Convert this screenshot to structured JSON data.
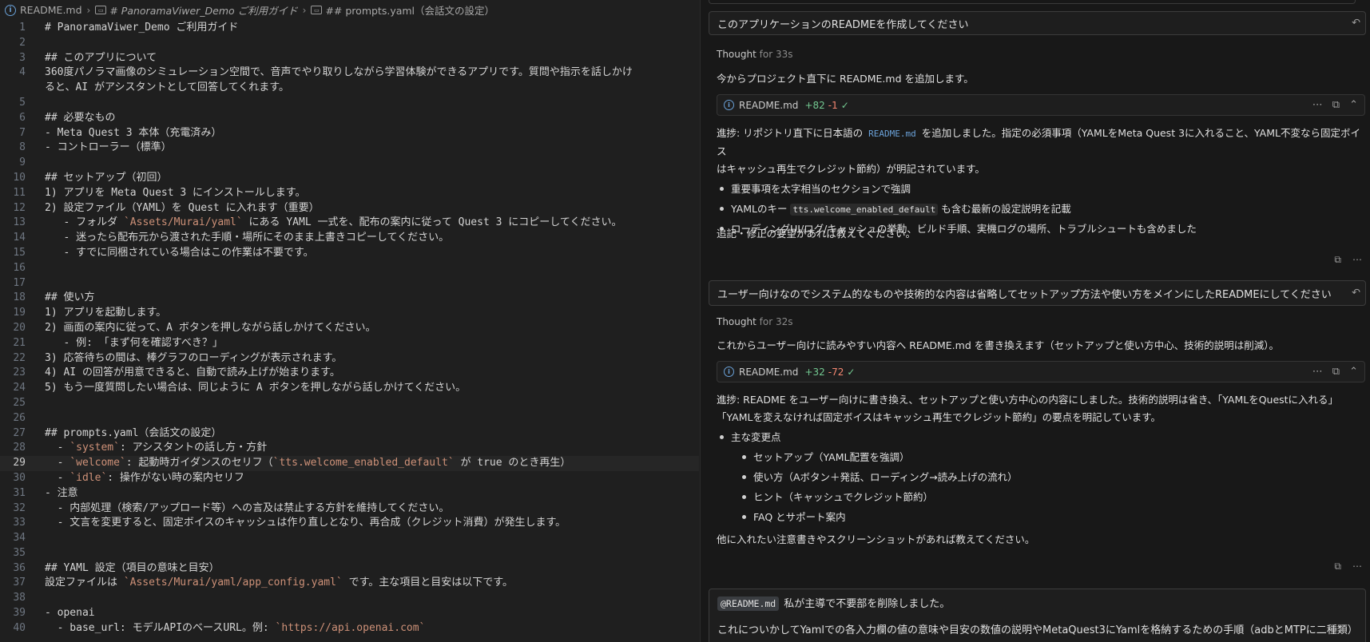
{
  "breadcrumb": {
    "file": "README.md",
    "section1": "# PanoramaViwer_Demo ご利用ガイド",
    "section2": "## prompts.yaml（会話文の設定）"
  },
  "editor": {
    "current_line": 29,
    "lines": [
      {
        "n": "1",
        "t": "# PanoramaViwer_Demo ご利用ガイド"
      },
      {
        "n": "2",
        "t": ""
      },
      {
        "n": "3",
        "t": "## このアプリについて"
      },
      {
        "n": "4",
        "t": "360度パノラマ画像のシミュレーション空間で、音声でやり取りしながら学習体験ができるアプリです。質問や指示を話しかけ"
      },
      {
        "n": "",
        "t": "ると、AI がアシスタントとして回答してくれます。"
      },
      {
        "n": "5",
        "t": ""
      },
      {
        "n": "6",
        "t": "## 必要なもの"
      },
      {
        "n": "7",
        "t": "- Meta Quest 3 本体（充電済み）"
      },
      {
        "n": "8",
        "t": "- コントローラー（標準）"
      },
      {
        "n": "9",
        "t": ""
      },
      {
        "n": "10",
        "t": "## セットアップ（初回）"
      },
      {
        "n": "11",
        "t": "1) アプリを Meta Quest 3 にインストールします。"
      },
      {
        "n": "12",
        "t": "2) 設定ファイル（YAML）を Quest に入れます（重要）"
      },
      {
        "n": "13",
        "t": "   - フォルダ `Assets/Murai/yaml` にある YAML 一式を、配布の案内に従って Quest 3 にコピーしてください。"
      },
      {
        "n": "14",
        "t": "   - 迷ったら配布元から渡された手順・場所にそのまま上書きコピーしてください。"
      },
      {
        "n": "15",
        "t": "   - すでに同梱されている場合はこの作業は不要です。"
      },
      {
        "n": "16",
        "t": ""
      },
      {
        "n": "17",
        "t": ""
      },
      {
        "n": "18",
        "t": "## 使い方"
      },
      {
        "n": "19",
        "t": "1) アプリを起動します。"
      },
      {
        "n": "20",
        "t": "2) 画面の案内に従って、A ボタンを押しながら話しかけてください。"
      },
      {
        "n": "21",
        "t": "   - 例: 「まず何を確認すべき？」"
      },
      {
        "n": "22",
        "t": "3) 応答待ちの間は、棒グラフのローディングが表示されます。"
      },
      {
        "n": "23",
        "t": "4) AI の回答が用意できると、自動で読み上げが始まります。"
      },
      {
        "n": "24",
        "t": "5) もう一度質問したい場合は、同じように A ボタンを押しながら話しかけてください。"
      },
      {
        "n": "25",
        "t": ""
      },
      {
        "n": "26",
        "t": ""
      },
      {
        "n": "27",
        "t": "## prompts.yaml（会話文の設定）"
      },
      {
        "n": "28",
        "t": "  - `system`: アシスタントの話し方・方針"
      },
      {
        "n": "29",
        "t": "  - `welcome`: 起動時ガイダンスのセリフ（`tts.welcome_enabled_default` が true のとき再生）"
      },
      {
        "n": "30",
        "t": "  - `idle`: 操作がない時の案内セリフ"
      },
      {
        "n": "31",
        "t": "- 注意"
      },
      {
        "n": "32",
        "t": "  - 内部処理（検索/アップロード等）への言及は禁止する方針を維持してください。"
      },
      {
        "n": "33",
        "t": "  - 文言を変更すると、固定ボイスのキャッシュは作り直しとなり、再合成（クレジット消費）が発生します。"
      },
      {
        "n": "34",
        "t": ""
      },
      {
        "n": "35",
        "t": ""
      },
      {
        "n": "36",
        "t": "## YAML 設定（項目の意味と目安）"
      },
      {
        "n": "37",
        "t": "設定ファイルは `Assets/Murai/yaml/app_config.yaml` です。主な項目と目安は以下です。"
      },
      {
        "n": "38",
        "t": ""
      },
      {
        "n": "39",
        "t": "- openai"
      },
      {
        "n": "40",
        "t": "  - base_url: モデルAPIのベースURL。例: `https://api.openai.com`"
      }
    ]
  },
  "chat": {
    "msg1": {
      "user": "このアプリケーションのREADMEを作成してください",
      "thought_label": "Thought",
      "thought_time": "for 33s",
      "intro": "今からプロジェクト直下に README.md を追加します。",
      "file_name": "README.md",
      "file_plus": "+82",
      "file_minus": "-1",
      "progress_a": "進捗: リポジトリ直下に日本語の ",
      "progress_code": "README.md",
      "progress_b": " を追加しました。指定の必須事項（YAMLをMeta Quest 3に入れること、YAML不変なら固定ボイス",
      "progress_c": "はキャッシュ再生でクレジット節約）が明記されています。",
      "bullet1": "重要事項を太字相当のセクションで強調",
      "bullet2_a": "YAMLのキー ",
      "bullet2_code": "tts.welcome_enabled_default",
      "bullet2_b": " も含む最新の設定説明を記載",
      "bullet3": "ローディングUI/ログ/キャッシュの挙動、ビルド手順、実機ログの場所、トラブルシュートも含めました",
      "closing": "追記・修正の要望があれば教えてください。"
    },
    "msg2": {
      "user": "ユーザー向けなのでシステム的なものや技術的な内容は省略してセットアップ方法や使い方をメインにしたREADMEにしてください",
      "thought_label": "Thought",
      "thought_time": "for 32s",
      "intro": "これからユーザー向けに読みやすい内容へ README.md を書き換えます（セットアップと使い方中心、技術的説明は削減）。",
      "file_name": "README.md",
      "file_plus": "+32",
      "file_minus": "-72",
      "progress_a": "進捗: README をユーザー向けに書き換え、セットアップと使い方中心の内容にしました。技術的説明は省き、「YAMLをQuestに入れる」",
      "progress_b": "「YAMLを変えなければ固定ボイスはキャッシュ再生でクレジット節約」の要点を明記しています。",
      "bullet_main": "主な変更点",
      "sub1": "セットアップ（YAML配置を強調）",
      "sub2": "使い方（Aボタン＋発話、ローディング→読み上げの流れ）",
      "sub3": "ヒント（キャッシュでクレジット節約）",
      "sub4": "FAQ とサポート案内",
      "closing": "他に入れたい注意書きやスクリーンショットがあれば教えてください。"
    },
    "msg3": {
      "mention": "@README.md",
      "line1": "私が主導で不要部を削除しました。",
      "line2": "これについかしてYamlでの各入力欄の値の意味や目安の数値の説明やMetaQuest3にYamlを格納するための手順（adbとMTPに二種類）"
    },
    "icons": {
      "undo": "↶",
      "copy": "⧉",
      "more": "⋯",
      "check": "✓"
    }
  }
}
